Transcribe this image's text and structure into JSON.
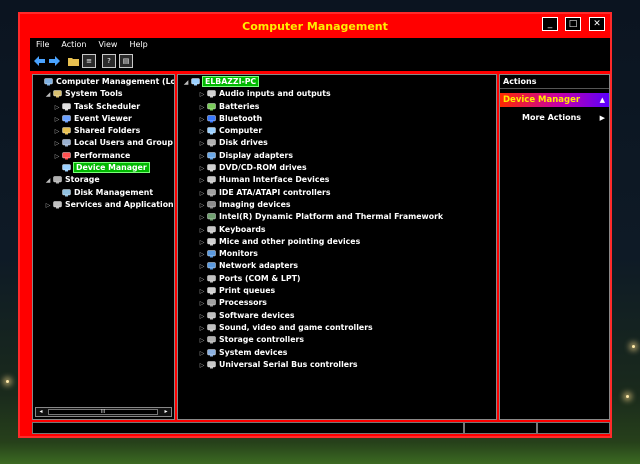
{
  "window": {
    "title": "Computer Management",
    "controls": {
      "minimize": "_",
      "maximize": "□",
      "close": "✕"
    }
  },
  "menu": [
    {
      "label": "File"
    },
    {
      "label": "Action"
    },
    {
      "label": "View"
    },
    {
      "label": "Help"
    }
  ],
  "toolbar": {
    "icons": [
      "back-arrow-icon",
      "forward-arrow-icon",
      "folder-icon",
      "properties-icon",
      "help-icon",
      "console-icon"
    ]
  },
  "left_tree": {
    "items": [
      {
        "label": "Computer Management (Loc",
        "arrow": "",
        "icon": "computer-management-icon",
        "level": 0
      },
      {
        "label": "System Tools",
        "arrow": "◢",
        "icon": "system-tools-icon",
        "level": 1
      },
      {
        "label": "Task Scheduler",
        "arrow": "▷",
        "icon": "clock-icon",
        "level": 2
      },
      {
        "label": "Event Viewer",
        "arrow": "▷",
        "icon": "event-viewer-icon",
        "level": 2
      },
      {
        "label": "Shared Folders",
        "arrow": "▷",
        "icon": "shared-folder-icon",
        "level": 2
      },
      {
        "label": "Local Users and Group",
        "arrow": "▷",
        "icon": "users-icon",
        "level": 2
      },
      {
        "label": "Performance",
        "arrow": "▷",
        "icon": "performance-icon",
        "level": 2
      },
      {
        "label": "Device Manager",
        "arrow": "",
        "icon": "device-manager-icon",
        "level": 2,
        "selected": true
      },
      {
        "label": "Storage",
        "arrow": "◢",
        "icon": "storage-icon",
        "level": 1
      },
      {
        "label": "Disk Management",
        "arrow": "",
        "icon": "disk-icon",
        "level": 2
      },
      {
        "label": "Services and Applications",
        "arrow": "▷",
        "icon": "services-icon",
        "level": 1
      }
    ],
    "scroll_thumb": "III",
    "scroll_left": "◂",
    "scroll_right": "▸"
  },
  "device_tree": {
    "root": {
      "label": "ELBAZZI-PC",
      "arrow": "◢",
      "icon": "computer-icon"
    },
    "items": [
      {
        "label": "Audio inputs and outputs",
        "icon": "audio-icon"
      },
      {
        "label": "Batteries",
        "icon": "battery-icon"
      },
      {
        "label": "Bluetooth",
        "icon": "bluetooth-icon"
      },
      {
        "label": "Computer",
        "icon": "computer-icon"
      },
      {
        "label": "Disk drives",
        "icon": "disk-drive-icon"
      },
      {
        "label": "Display adapters",
        "icon": "display-icon"
      },
      {
        "label": "DVD/CD-ROM drives",
        "icon": "dvd-icon"
      },
      {
        "label": "Human Interface Devices",
        "icon": "hid-icon"
      },
      {
        "label": "IDE ATA/ATAPI controllers",
        "icon": "ide-icon"
      },
      {
        "label": "Imaging devices",
        "icon": "camera-icon"
      },
      {
        "label": "Intel(R) Dynamic Platform and Thermal Framework",
        "icon": "chip-icon"
      },
      {
        "label": "Keyboards",
        "icon": "keyboard-icon"
      },
      {
        "label": "Mice and other pointing devices",
        "icon": "mouse-icon"
      },
      {
        "label": "Monitors",
        "icon": "monitor-icon"
      },
      {
        "label": "Network adapters",
        "icon": "network-icon"
      },
      {
        "label": "Ports (COM & LPT)",
        "icon": "port-icon"
      },
      {
        "label": "Print queues",
        "icon": "printer-icon"
      },
      {
        "label": "Processors",
        "icon": "processor-icon"
      },
      {
        "label": "Software devices",
        "icon": "software-device-icon"
      },
      {
        "label": "Sound, video and game controllers",
        "icon": "sound-icon"
      },
      {
        "label": "Storage controllers",
        "icon": "storage-controller-icon"
      },
      {
        "label": "System devices",
        "icon": "system-device-icon"
      },
      {
        "label": "Universal Serial Bus controllers",
        "icon": "usb-icon"
      }
    ],
    "collapsed_arrow": "▷"
  },
  "actions": {
    "header": "Actions",
    "group": "Device Manager",
    "group_caret": "▲",
    "items": [
      {
        "label": "More Actions",
        "caret": "▶"
      }
    ]
  },
  "colors": {
    "frame": "#ff0000",
    "title_text": "#ffee00",
    "selected_bg": "#00b800",
    "root_bg": "#00b800"
  }
}
